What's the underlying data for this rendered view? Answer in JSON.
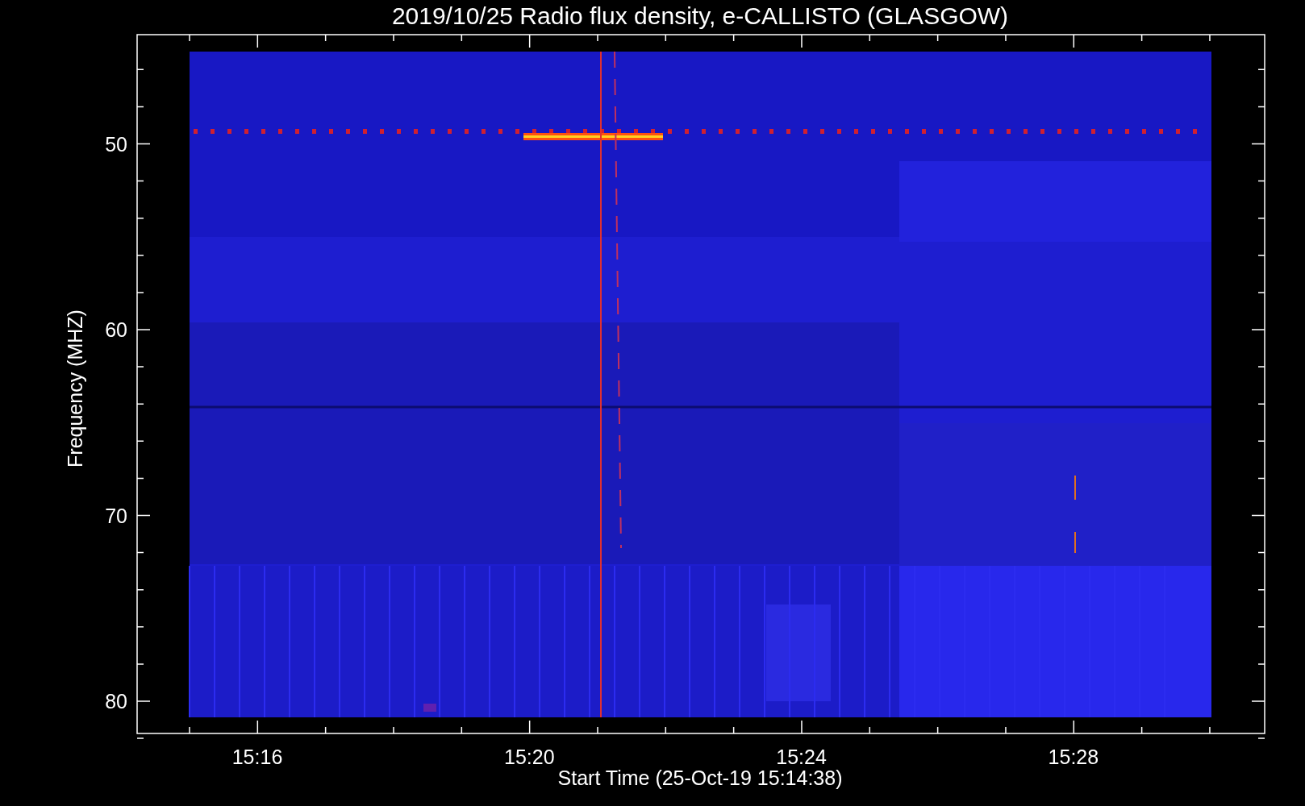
{
  "plot": {
    "title": "2019/10/25  Radio flux density, e-CALLISTO (GLASGOW)",
    "ylabel": "Frequency (MHZ)",
    "xlabel": "Start Time (25-Oct-19 15:14:38)",
    "yticks": [
      "50",
      "60",
      "70",
      "80"
    ],
    "xticks": [
      "15:16",
      "15:20",
      "15:24",
      "15:28"
    ]
  }
}
